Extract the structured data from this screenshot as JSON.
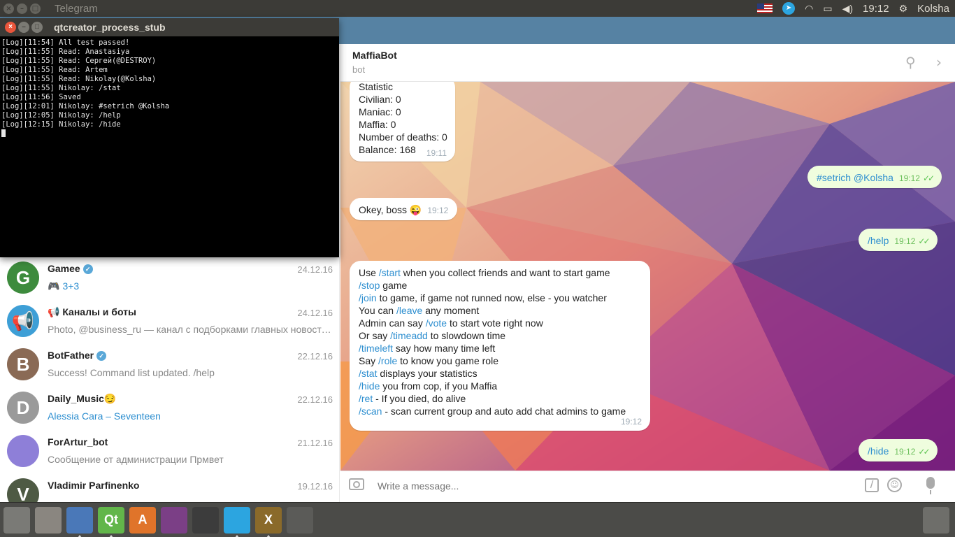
{
  "top_panel": {
    "window_title": "Telegram",
    "clock": "19:12",
    "user": "Kolsha"
  },
  "terminal": {
    "title": "qtcreator_process_stub",
    "lines": [
      "[Log][11:54] All test passed!",
      "[Log][11:55] Read: Anastasiya",
      "[Log][11:55] Read: Сергей(@DESTROY)",
      "[Log][11:55] Read: Artem",
      "[Log][11:55] Read: Nikolay(@Kolsha)",
      "[Log][11:55] Nikolay: /stat",
      "[Log][11:56] Saved",
      "[Log][12:01] Nikolay: #setrich @Kolsha",
      "[Log][12:05] Nikolay: /help",
      "[Log][12:15] Nikolay: /hide"
    ]
  },
  "chat_list": [
    {
      "name": "Gamee",
      "verified": true,
      "date": "24.12.16",
      "preview_prefix": "🎮",
      "preview": "3+3",
      "preview_blue": true,
      "avatar_letter": "G",
      "avatar_color": "#3d8b3d"
    },
    {
      "name": "📢 Каналы и боты",
      "verified": false,
      "date": "24.12.16",
      "preview_prefix": "",
      "preview": "Photo, @business_ru  — канал с подборками главных новостей…",
      "preview_blue": false,
      "avatar_letter": "📢",
      "avatar_color": "#3e9fd6"
    },
    {
      "name": "BotFather",
      "verified": true,
      "date": "22.12.16",
      "preview_prefix": "",
      "preview": "Success! Command list updated. /help",
      "preview_blue": false,
      "avatar_letter": "B",
      "avatar_color": "#8a6a55"
    },
    {
      "name": "Daily_Music😏",
      "verified": false,
      "date": "22.12.16",
      "preview_prefix": "",
      "preview": "Alessia Cara – Seventeen",
      "preview_blue": true,
      "avatar_letter": "D",
      "avatar_color": "#9a9a9a"
    },
    {
      "name": "ForArtur_bot",
      "verified": false,
      "date": "21.12.16",
      "preview_prefix": "",
      "preview": "Сообщение от администрации Прмвет",
      "preview_blue": false,
      "avatar_letter": "",
      "avatar_color": "#8e7fd8"
    },
    {
      "name": "Vladimir Parfinenko",
      "verified": false,
      "date": "19.12.16",
      "preview_prefix": "",
      "preview": "",
      "preview_blue": false,
      "avatar_letter": "V",
      "avatar_color": "#4e5a44"
    }
  ],
  "chat": {
    "peer_name": "MaffiaBot",
    "peer_status": "bot",
    "composer_placeholder": "Write a message...",
    "stats_msg": {
      "lines": [
        "Statistic",
        "Civilian: 0",
        "Maniac: 0",
        "Maffia: 0",
        "Number of deaths: 0",
        "Balance: 168"
      ],
      "time": "19:11"
    },
    "setrich_msg": {
      "text": "#setrich @Kolsha",
      "time": "19:12"
    },
    "okey_msg": {
      "text": "Okey, boss 😜",
      "time": "19:12"
    },
    "help_cmd_msg": {
      "text": "/help",
      "time": "19:12"
    },
    "help_msg": {
      "lines": [
        {
          "pre": "Use ",
          "cmd": "/start",
          "post": " when you collect friends and want to start game"
        },
        {
          "pre": "",
          "cmd": "/stop",
          "post": " game"
        },
        {
          "pre": "",
          "cmd": "/join",
          "post": " to game, if game not runned now, else - you watcher"
        },
        {
          "pre": "You can ",
          "cmd": "/leave",
          "post": " any moment"
        },
        {
          "pre": "Admin can say ",
          "cmd": "/vote",
          "post": " to start vote right now"
        },
        {
          "pre": "Or say ",
          "cmd": "/timeadd",
          "post": " to slowdown time"
        },
        {
          "pre": "",
          "cmd": "/timeleft",
          "post": " say how many time left"
        },
        {
          "pre": "Say ",
          "cmd": "/role",
          "post": " to know you game role"
        },
        {
          "pre": "",
          "cmd": "/stat",
          "post": " displays your statistics"
        },
        {
          "pre": "",
          "cmd": "/hide",
          "post": " you from cop, if you Maffia"
        },
        {
          "pre": "",
          "cmd": "/ret",
          "post": " - If you died, do alive"
        },
        {
          "pre": "",
          "cmd": "/scan",
          "post": " - scan current group and auto add chat admins to game"
        }
      ],
      "time": "19:12"
    },
    "hide_cmd_msg": {
      "text": "/hide",
      "time": "19:12"
    }
  },
  "dock": {
    "items": [
      {
        "name": "ubuntu-dash",
        "label": "",
        "color": "#7a7a76",
        "running": false
      },
      {
        "name": "files",
        "label": "",
        "color": "#8a8680",
        "running": false
      },
      {
        "name": "chromium",
        "label": "",
        "color": "#4a78b8",
        "running": true
      },
      {
        "name": "qt-creator",
        "label": "Qt",
        "color": "#62b64a",
        "running": true
      },
      {
        "name": "software-center",
        "label": "A",
        "color": "#e0742a",
        "running": false
      },
      {
        "name": "media-app",
        "label": "",
        "color": "#7b3f86",
        "running": false
      },
      {
        "name": "clock-app",
        "label": "",
        "color": "#3c3c3c",
        "running": false
      },
      {
        "name": "telegram",
        "label": "",
        "color": "#2ca5e0",
        "running": true
      },
      {
        "name": "xterm",
        "label": "X",
        "color": "#8a6a2a",
        "running": true
      },
      {
        "name": "workspaces",
        "label": "",
        "color": "#5b5b58",
        "running": false
      }
    ]
  }
}
